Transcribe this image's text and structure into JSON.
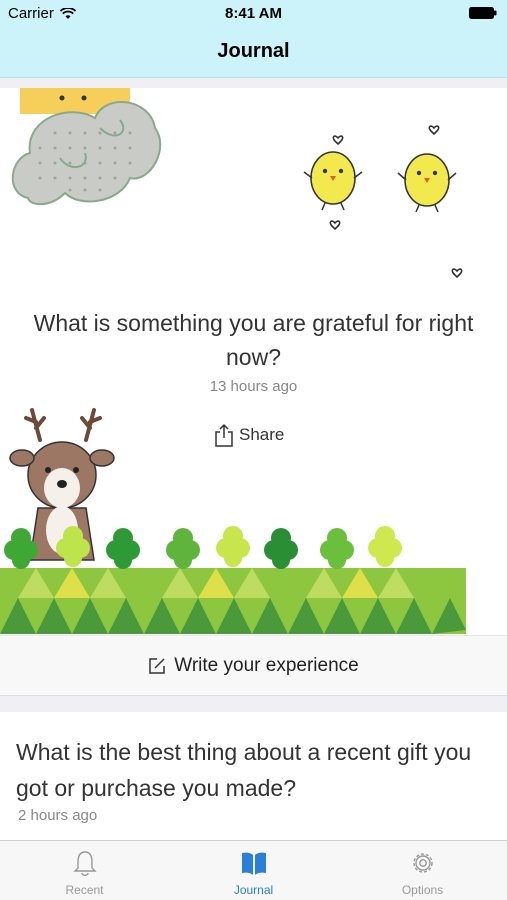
{
  "status_bar": {
    "carrier": "Carrier",
    "time": "8:41 AM"
  },
  "nav": {
    "title": "Journal"
  },
  "cards": [
    {
      "question": "What is something you are grateful for right now?",
      "time_ago": "13 hours ago",
      "share_label": "Share",
      "write_label": "Write your experience"
    },
    {
      "question": "What is the best thing about a recent gift you got or purchase you made?",
      "time_ago": "2 hours ago"
    }
  ],
  "tabs": [
    {
      "label": "Recent",
      "icon": "bell-icon",
      "active": false
    },
    {
      "label": "Journal",
      "icon": "book-icon",
      "active": true
    },
    {
      "label": "Options",
      "icon": "gear-icon",
      "active": false
    }
  ],
  "colors": {
    "header_bg": "#ccf3fa",
    "active_tab": "#2a7fd9",
    "inactive_tab": "#999999"
  }
}
